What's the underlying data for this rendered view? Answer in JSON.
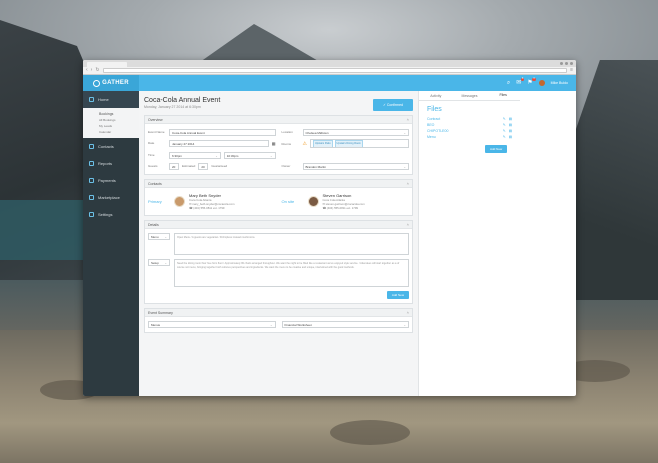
{
  "app": {
    "brand": "GATHER",
    "user_name": "Mike Buldo",
    "messages_badge": "3",
    "notifications_badge": "3"
  },
  "sidebar": {
    "items": [
      {
        "label": "Home",
        "icon": "home-icon"
      },
      {
        "label": "Contacts",
        "icon": "contacts-icon"
      },
      {
        "label": "Reports",
        "icon": "reports-icon"
      },
      {
        "label": "Payments",
        "icon": "payments-icon"
      },
      {
        "label": "Marketplace",
        "icon": "marketplace-icon"
      },
      {
        "label": "Settings",
        "icon": "settings-icon"
      }
    ],
    "sub": {
      "header": "Bookings",
      "items": [
        "All Bookings",
        "My Leads",
        "Calendar"
      ]
    }
  },
  "page": {
    "title": "Coca-Cola Annual Event",
    "subtitle": "Monday, January 27 2014 at 6:30pm",
    "confirm_label": "Confirmed"
  },
  "overview": {
    "title": "Overview",
    "event_name_label": "Event Name",
    "event_name": "Coca-Cola Annual Event",
    "date_label": "Date",
    "date": "January 27 2014",
    "time_label": "Time",
    "time_start": "6:30pm",
    "time_end": "10:30pm",
    "guests_label": "Guests",
    "guests_estimated": "20",
    "guests_estimated_label": "Estimated",
    "guests_guaranteed": "20",
    "guests_guaranteed_label": "Guaranteed",
    "location_label": "Location",
    "location": "Chelsea Midtown",
    "rooms_label": "Rooms",
    "rooms": [
      "Upstairs Patio",
      "Upstairs Dining Room"
    ],
    "owner_label": "Owner",
    "owner": "Brandon Martin"
  },
  "contacts": {
    "title": "Contacts",
    "primary": {
      "role": "Primary",
      "name": "Mary Beth Snyder",
      "company": "Coca Cola Atlanta",
      "email": "mary_beth.snyder@cocacola.com",
      "phone": "(404) 555-0811 ext. 1799"
    },
    "onsite": {
      "role": "On site",
      "name": "Steven Garrison",
      "company": "Coca Cola Atlanta",
      "email": "steven.garrison@cocacola.com",
      "phone": "(404) 555-0811 ext. 1799"
    }
  },
  "details": {
    "title": "Details",
    "row1_select": "Menu",
    "row1_text": "Open Menu / A guests are vegetarian. Shrimpless instead mushrooms.",
    "row2_select": "Setup",
    "row2_text": "Need the dining room floor free from floor / Approximately 80 chairs arranged throughout. We want the night to be filled like a restaurant we've enjoyed style service. / Attendees will start together as a of course not menu, bringing together both cultures perspectives and ingredients. We want the menu to be creative and unique, intertwined with the good methods.",
    "add_new_label": "Add New"
  },
  "event_summary": {
    "title": "Event Summary",
    "left_select": "Menus",
    "right_select": "Financial Worksheet"
  },
  "right_panel": {
    "tabs": [
      "Activity",
      "Messages",
      "Files"
    ],
    "files_title": "Files",
    "files": [
      "Contract",
      "BEO",
      "CHIPOTLE00",
      "Menu"
    ],
    "add_new_label": "Add New"
  },
  "colors": {
    "accent": "#4ab6e8",
    "sidebar_bg": "#2d3a40"
  }
}
